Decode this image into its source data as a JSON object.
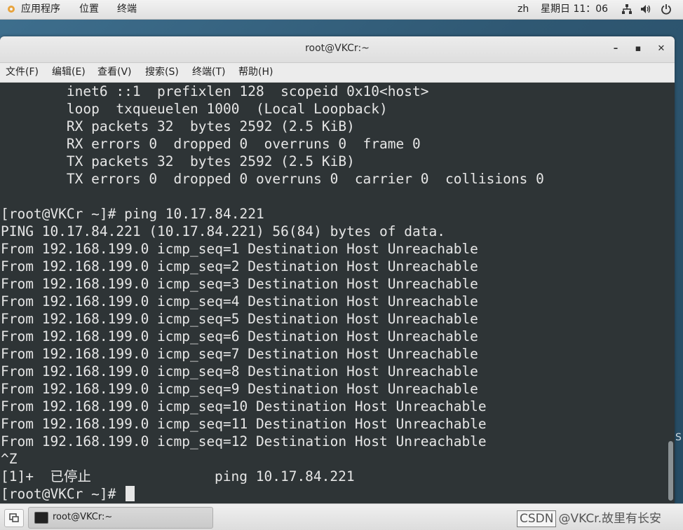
{
  "topbar": {
    "apps": "应用程序",
    "places": "位置",
    "terminal": "终端",
    "lang": "zh",
    "clock": "星期日 11：06",
    "icons": [
      "network-icon",
      "volume-icon",
      "power-icon"
    ]
  },
  "window": {
    "title": "root@VKCr:~",
    "controls": {
      "minimize": "–",
      "maximize": "▪",
      "close": "✕"
    }
  },
  "menubar": {
    "items": [
      "文件(F)",
      "编辑(E)",
      "查看(V)",
      "搜索(S)",
      "终端(T)",
      "帮助(H)"
    ]
  },
  "terminal": {
    "lines": [
      "        inet6 ::1  prefixlen 128  scopeid 0x10<host>",
      "        loop  txqueuelen 1000  (Local Loopback)",
      "        RX packets 32  bytes 2592 (2.5 KiB)",
      "        RX errors 0  dropped 0  overruns 0  frame 0",
      "        TX packets 32  bytes 2592 (2.5 KiB)",
      "        TX errors 0  dropped 0 overruns 0  carrier 0  collisions 0",
      "",
      "[root@VKCr ~]# ping 10.17.84.221",
      "PING 10.17.84.221 (10.17.84.221) 56(84) bytes of data.",
      "From 192.168.199.0 icmp_seq=1 Destination Host Unreachable",
      "From 192.168.199.0 icmp_seq=2 Destination Host Unreachable",
      "From 192.168.199.0 icmp_seq=3 Destination Host Unreachable",
      "From 192.168.199.0 icmp_seq=4 Destination Host Unreachable",
      "From 192.168.199.0 icmp_seq=5 Destination Host Unreachable",
      "From 192.168.199.0 icmp_seq=6 Destination Host Unreachable",
      "From 192.168.199.0 icmp_seq=7 Destination Host Unreachable",
      "From 192.168.199.0 icmp_seq=8 Destination Host Unreachable",
      "From 192.168.199.0 icmp_seq=9 Destination Host Unreachable",
      "From 192.168.199.0 icmp_seq=10 Destination Host Unreachable",
      "From 192.168.199.0 icmp_seq=11 Destination Host Unreachable",
      "From 192.168.199.0 icmp_seq=12 Destination Host Unreachable",
      "^Z",
      "[1]+  已停止               ping 10.17.84.221",
      "[root@VKCr ~]# "
    ]
  },
  "taskbar": {
    "task_label": "root@VKCr:~",
    "watermark_badge": "CSDN",
    "watermark_text": "@VKCr.故里有长安"
  },
  "desktop_edge_text": "S"
}
